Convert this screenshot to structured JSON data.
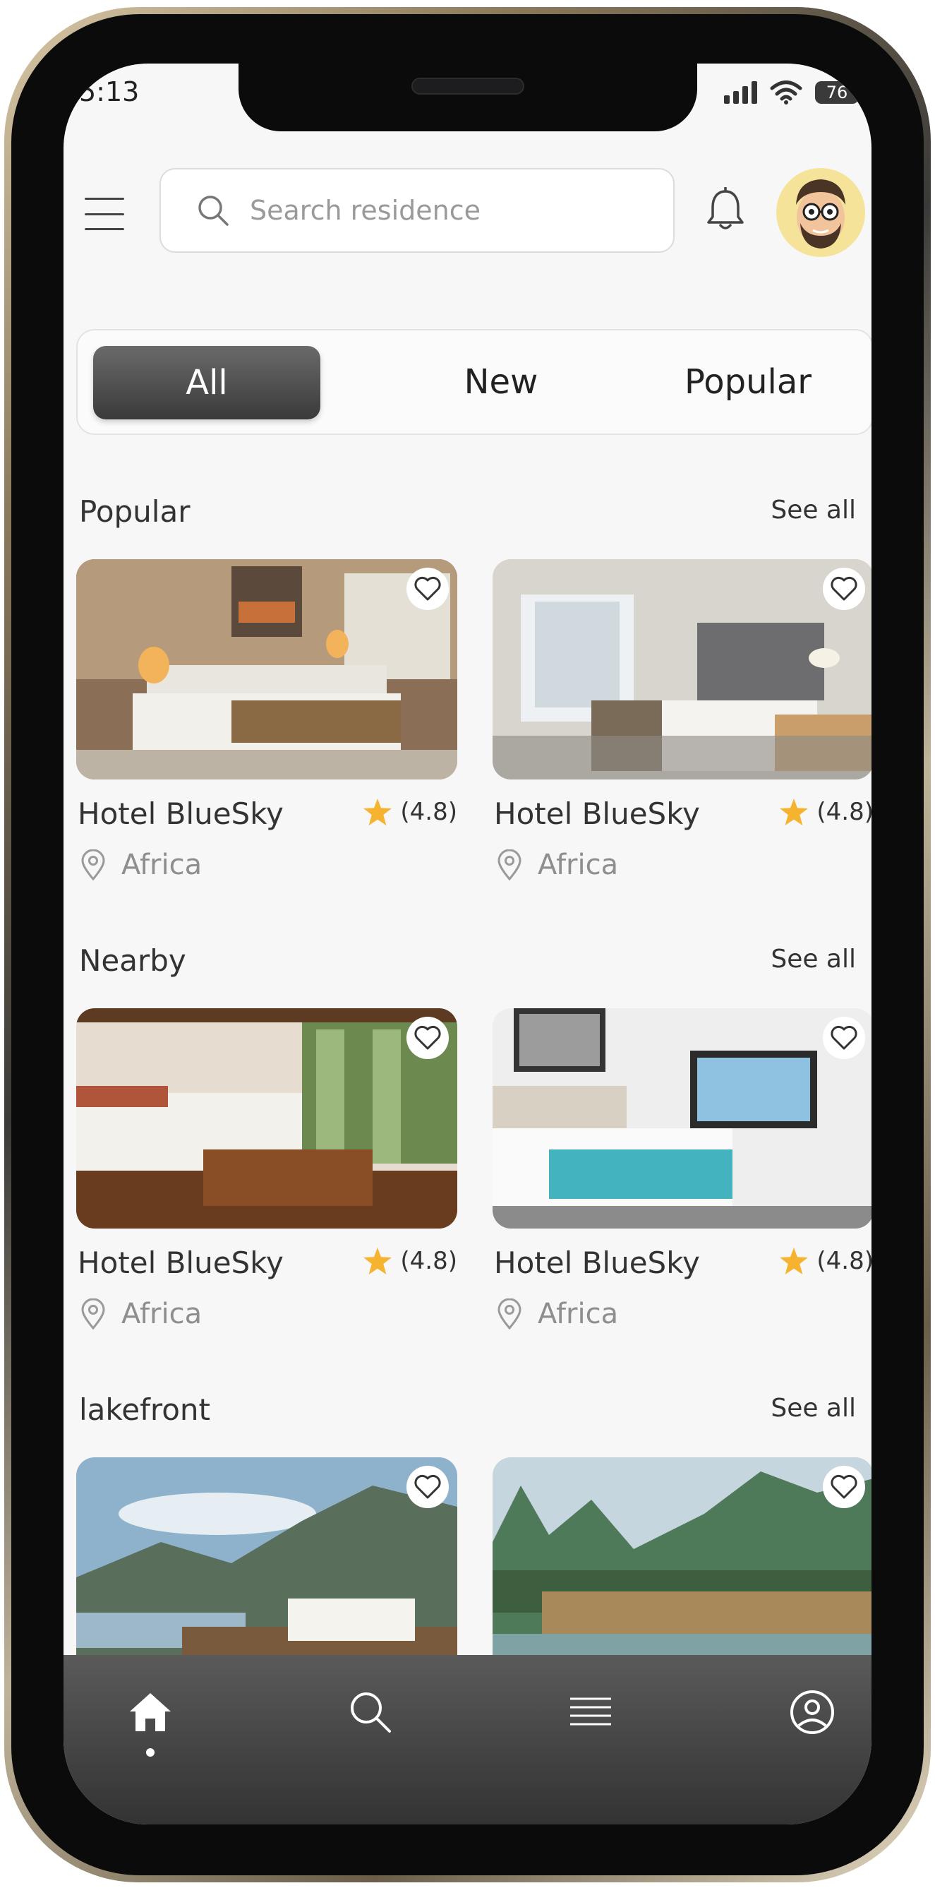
{
  "status_bar": {
    "time": "5:13",
    "battery": "76"
  },
  "search": {
    "placeholder": "Search residence"
  },
  "tabs": [
    {
      "label": "All",
      "active": true
    },
    {
      "label": "New",
      "active": false
    },
    {
      "label": "Popular",
      "active": false
    }
  ],
  "sections": {
    "popular": {
      "title": "Popular",
      "see_all": "See all",
      "cards": [
        {
          "name": "Hotel BlueSky",
          "rating": "(4.8)",
          "location": "Africa"
        },
        {
          "name": "Hotel BlueSky",
          "rating": "(4.8)",
          "location": "Africa"
        }
      ]
    },
    "nearby": {
      "title": "Nearby",
      "see_all": "See all",
      "cards": [
        {
          "name": "Hotel BlueSky",
          "rating": "(4.8)",
          "location": "Africa"
        },
        {
          "name": "Hotel BlueSky",
          "rating": "(4.8)",
          "location": "Africa"
        }
      ]
    },
    "lakefront": {
      "title": "lakefront",
      "see_all": "See all"
    }
  },
  "colors": {
    "accent_dark": "#3a3a3a",
    "star": "#f5b330",
    "avatar_bg": "#f6e39a"
  },
  "icons": {
    "nav": [
      "home-icon",
      "search-icon",
      "list-icon",
      "profile-icon"
    ],
    "header": [
      "menu-icon",
      "search-icon",
      "bell-icon",
      "avatar"
    ]
  }
}
